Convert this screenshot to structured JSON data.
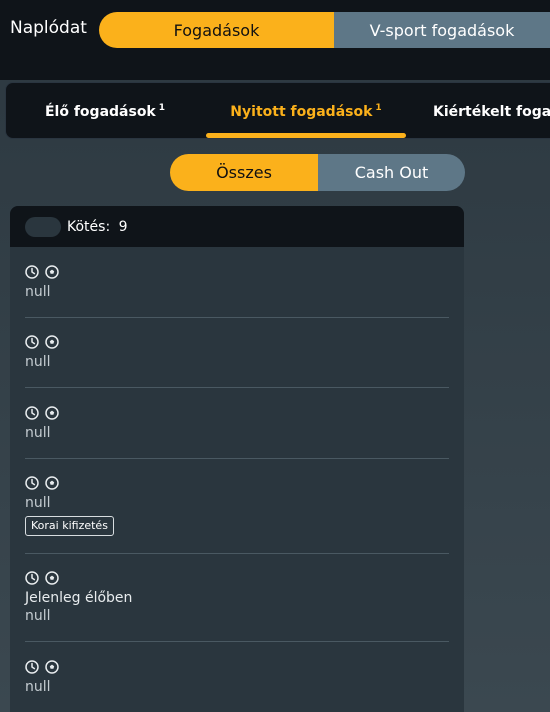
{
  "header": {
    "title": "Naplódat",
    "tabs": [
      {
        "label": "Fogadások",
        "active": true
      },
      {
        "label": "V-sport fogadások",
        "active": false
      }
    ]
  },
  "subtabs": [
    {
      "label": "Élő fogadások",
      "count": "1",
      "active": false
    },
    {
      "label": "Nyitott fogadások",
      "count": "1",
      "active": true
    },
    {
      "label": "Kiértékelt fogadások",
      "count": "",
      "active": false
    }
  ],
  "filter": {
    "all_label": "Összes",
    "cashout_label": "Cash Out"
  },
  "list": {
    "count_label": "Kötés:",
    "count_value": "9",
    "items": [
      {
        "text": "null"
      },
      {
        "text": "null"
      },
      {
        "text": "null"
      },
      {
        "text": "null",
        "badge": "Korai kifizetés"
      },
      {
        "live": "Jelenleg élőben",
        "text": "null"
      },
      {
        "text": "null"
      }
    ]
  },
  "colors": {
    "accent": "#fbb11b",
    "inactive_tab": "#5e7787",
    "header_bg": "#0f1419",
    "card_bg": "#2a363e"
  }
}
